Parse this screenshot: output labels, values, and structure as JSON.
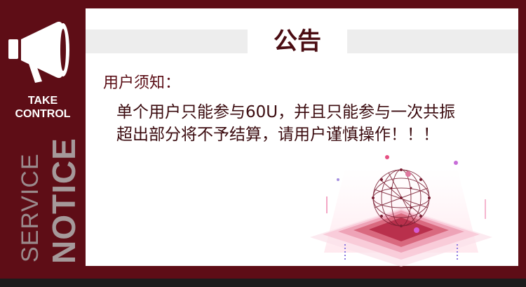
{
  "sidebar": {
    "take": "TAKE",
    "control": "CONTROL",
    "service": "SERVICE",
    "notice": "NOTICE"
  },
  "notice": {
    "title": "公告",
    "greeting": "用户须知：",
    "line1": "单个用户只能参与60U，并且只能参与一次共振",
    "line2": "超出部分将不予结算，请用户谨慎操作！！！"
  },
  "colors": {
    "frame": "#5e0d16",
    "card": "#ffffff",
    "title_bar": "#ededed",
    "text_dark_red": "#4a0c12",
    "sidebar_vertical_text": "#9a8a8c"
  },
  "icons": {
    "megaphone": "megaphone-icon",
    "illustration": "network-sphere-illustration"
  }
}
